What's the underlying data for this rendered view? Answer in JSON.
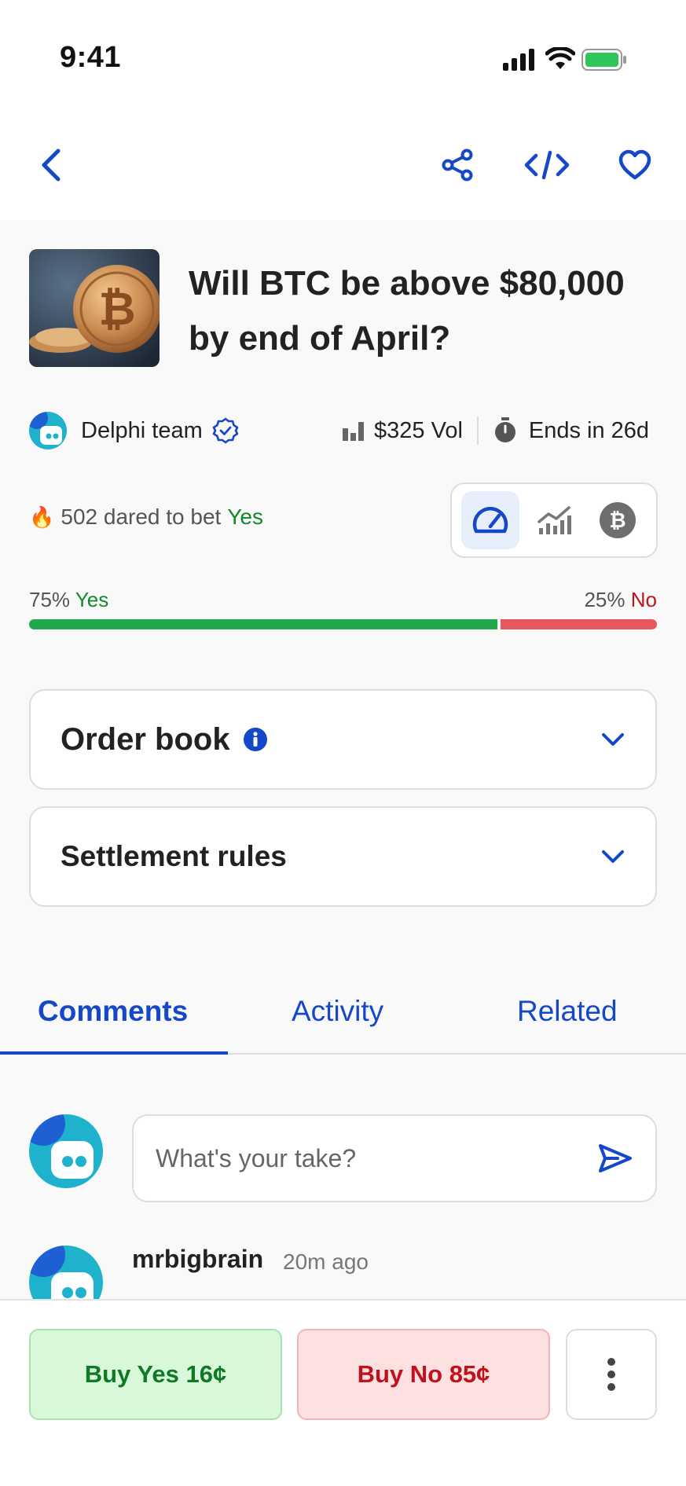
{
  "status_bar": {
    "time": "9:41"
  },
  "market": {
    "title": "Will BTC be above $80,000 by end of April?",
    "creator": "Delphi team",
    "volume": "$325 Vol",
    "ends": "Ends in 26d",
    "dared_text": "502 dared to bet",
    "dared_side": "Yes",
    "yes_pct": "75%",
    "yes_label": "Yes",
    "no_pct": "25%",
    "no_label": "No",
    "yes_fraction": 0.75
  },
  "sections": {
    "order_book": "Order book",
    "settlement_rules": "Settlement rules"
  },
  "tabs": [
    {
      "label": "Comments"
    },
    {
      "label": "Activity"
    },
    {
      "label": "Related"
    }
  ],
  "comments": {
    "input_placeholder": "What's your take?",
    "first": {
      "user": "mrbigbrain",
      "time": "20m ago"
    }
  },
  "actions": {
    "buy_yes": "Buy Yes 16¢",
    "buy_no": "Buy No 85¢"
  },
  "colors": {
    "accent": "#1448c8",
    "yes": "#22a74a",
    "no": "#e8565f",
    "avatar": "#1fb2cc"
  }
}
